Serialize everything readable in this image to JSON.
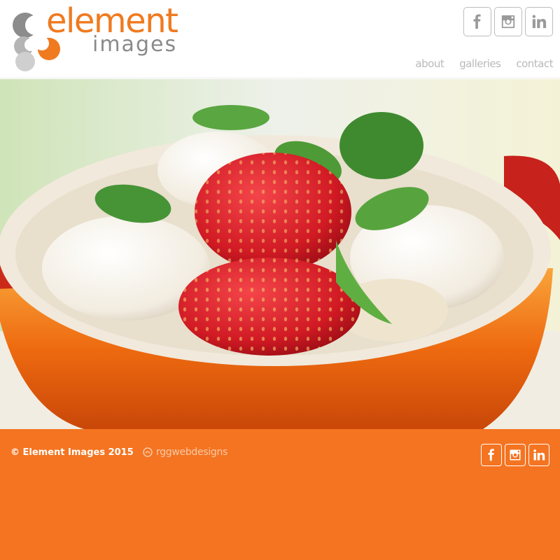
{
  "brand": {
    "line1": "element",
    "line2": "images"
  },
  "nav": [
    {
      "label": "about"
    },
    {
      "label": "galleries"
    },
    {
      "label": "contact"
    }
  ],
  "social": [
    "facebook-icon",
    "instagram-icon",
    "linkedin-icon"
  ],
  "footer": {
    "copyright": "© Element Images 2015",
    "credit": "rggwebdesigns"
  },
  "colors": {
    "accent": "#f07a1f",
    "footer_bg": "#f47421",
    "nav_text": "#b9b9b9"
  }
}
